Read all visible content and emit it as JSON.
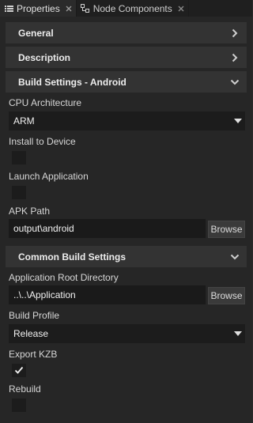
{
  "tabs": [
    {
      "label": "Properties",
      "icon": "list-icon"
    },
    {
      "label": "Node Components",
      "icon": "node-components-icon"
    }
  ],
  "sections": {
    "general": "General",
    "description": "Description",
    "build_android": "Build Settings - Android",
    "common_build": "Common Build Settings"
  },
  "android": {
    "cpu_label": "CPU Architecture",
    "cpu_value": "ARM",
    "install_label": "Install to Device",
    "launch_label": "Launch Application",
    "apk_label": "APK Path",
    "apk_value": "output\\android",
    "browse_label": "Browse"
  },
  "common": {
    "root_label": "Application Root Directory",
    "root_value": "..\\..\\Application",
    "browse_label": "Browse",
    "profile_label": "Build Profile",
    "profile_value": "Release",
    "export_label": "Export KZB",
    "export_checked": true,
    "rebuild_label": "Rebuild"
  },
  "colors": {
    "background": "#262626",
    "header": "#333333",
    "field": "#1c1c1c",
    "text": "#d8d8d8"
  }
}
